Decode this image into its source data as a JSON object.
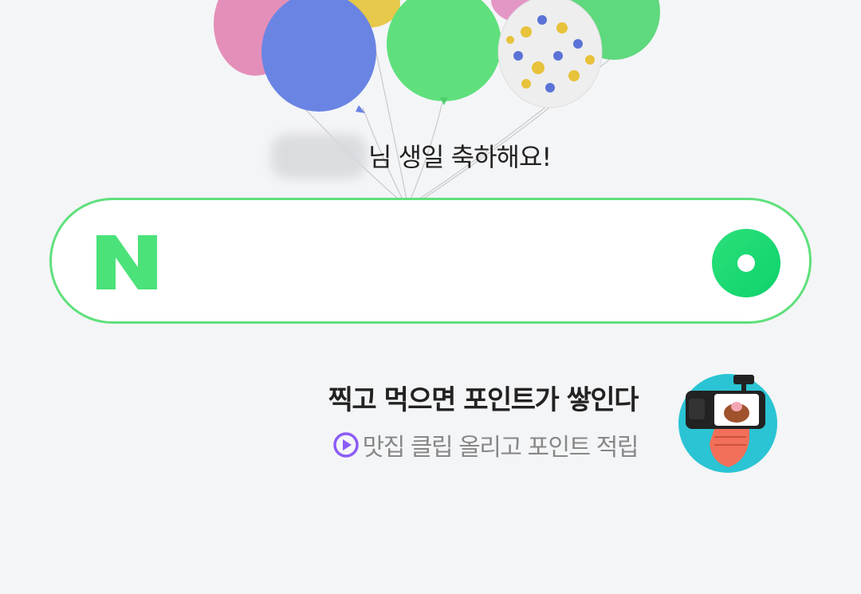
{
  "greeting": {
    "suffix": "님 생일 축하해요!"
  },
  "search": {
    "placeholder": "",
    "value": "",
    "logo_letter": "N"
  },
  "promo": {
    "title": "찍고 먹으면 포인트가 쌓인다",
    "subtitle": "맛집 클립 올리고 포인트 적립"
  },
  "colors": {
    "brand": "#03c75a",
    "border": "#5fe07c",
    "logo": "#4be27a",
    "subtitle_icon": "#8b5cf6"
  }
}
